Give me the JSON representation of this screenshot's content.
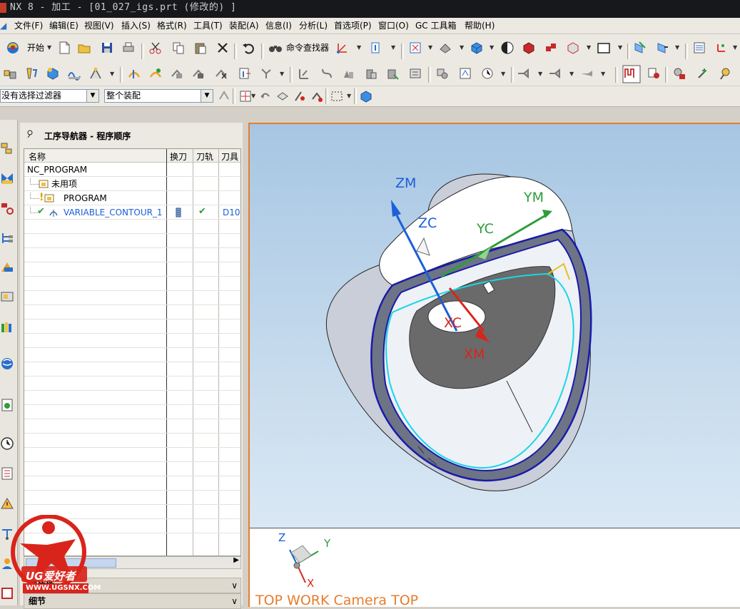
{
  "window": {
    "title": "NX 8 - 加工 - [01_027_igs.prt  (修改的) ]"
  },
  "menu": [
    "文件(F)",
    "编辑(E)",
    "视图(V)",
    "插入(S)",
    "格式(R)",
    "工具(T)",
    "装配(A)",
    "信息(I)",
    "分析(L)",
    "首选项(P)",
    "窗口(O)",
    "GC 工具箱",
    "帮助(H)"
  ],
  "toolbar": {
    "start_label": "开始",
    "command_finder_label": "命令查找器"
  },
  "selection_bar": {
    "filter_value": "没有选择过滤器",
    "scope_value": "整个装配"
  },
  "navigator": {
    "title": "工序导航器 - 程序顺序",
    "columns": [
      "名称",
      "换刀",
      "刀轨",
      "刀具"
    ],
    "rows": [
      {
        "name": "NC_PROGRAM"
      },
      {
        "name": "未用项"
      },
      {
        "name": "PROGRAM"
      },
      {
        "name": "VARIABLE_CONTOUR_1",
        "tool": "D10"
      }
    ],
    "panels": [
      "相依性",
      "细节"
    ]
  },
  "viewport": {
    "axis_labels": {
      "zm": "ZM",
      "zc": "ZC",
      "ym": "YM",
      "yc": "YC",
      "xc": "XC",
      "xm": "XM"
    },
    "triad_labels": {
      "z": "Z",
      "y": "Y",
      "x": "X"
    },
    "view_label": "TOP WORK Camera TOP"
  },
  "watermark": {
    "brand": "UG爱好者",
    "url": "WWW.UGSNX.COM"
  },
  "colors": {
    "accent_orange": "#e57d2c",
    "axis_blue": "#1c5fd6",
    "axis_green": "#2e9d3b",
    "axis_red": "#d9241b",
    "toolpath_cyan": "#1ad6e8",
    "model_edge": "#1a1aa8"
  }
}
